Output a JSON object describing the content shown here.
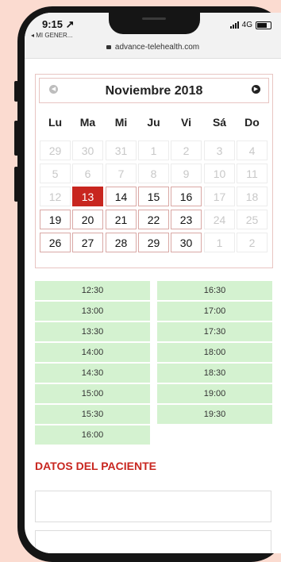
{
  "status": {
    "time": "9:15 ↗",
    "back_app": "◂ MI GENER...",
    "network": "4G",
    "url": "advance-telehealth.com"
  },
  "calendar": {
    "month": "Noviembre 2018",
    "weekdays": [
      "Lu",
      "Ma",
      "Mi",
      "Ju",
      "Vi",
      "Sá",
      "Do"
    ],
    "rows": [
      [
        "29",
        "30",
        "31",
        "1",
        "2",
        "3",
        "4"
      ],
      [
        "5",
        "6",
        "7",
        "8",
        "9",
        "10",
        "11"
      ],
      [
        "12",
        "13",
        "14",
        "15",
        "16",
        "17",
        "18"
      ],
      [
        "19",
        "20",
        "21",
        "22",
        "23",
        "24",
        "25"
      ],
      [
        "26",
        "27",
        "28",
        "29",
        "30",
        "1",
        "2"
      ]
    ],
    "selected_day": "13"
  },
  "time_slots": {
    "left": [
      "12:30",
      "13:00",
      "13:30",
      "14:00",
      "14:30",
      "15:00",
      "15:30",
      "16:00"
    ],
    "right": [
      "16:30",
      "17:00",
      "17:30",
      "18:00",
      "18:30",
      "19:00",
      "19:30"
    ]
  },
  "patient": {
    "title": "DATOS DEL PACIENTE"
  },
  "colors": {
    "accent": "#c8261f",
    "slot_bg": "#d4f2d0",
    "page_bg": "#fbdbd0"
  }
}
